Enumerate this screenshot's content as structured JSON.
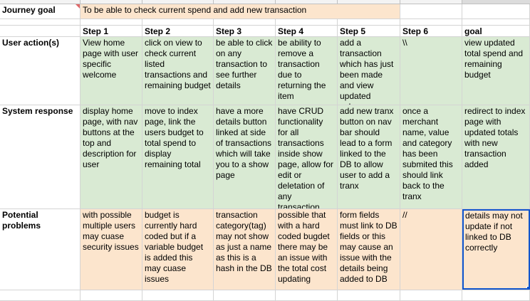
{
  "sheet": {
    "journey_goal_label": "Journey goal",
    "journey_goal_text": "To be able to check current spend and add new transaction",
    "step_headers": [
      "Step 1",
      "Step 2",
      "Step 3",
      "Step 4",
      "Step 5",
      "Step 6",
      "goal"
    ],
    "rows": [
      {
        "label": "User action(s)",
        "cells": [
          "View home page with user specific welcome",
          "click on view to check current listed transactions and remaining budget",
          "be able to click on any transaction to see further details",
          "be ability to remove a transaction due to returning the item",
          "add a transaction which has just been made and view updated values",
          "\\\\",
          "view updated total spend and remaining budget"
        ]
      },
      {
        "label": "System response",
        "cells": [
          "display home page, with nav buttons at the top and description for user",
          "move to index page, link the users budget to total spend to display remaining total",
          "have a more details button linked at side of transactions which will take you to a show page",
          "have CRUD functionality for all transactions inside show page, allow for edit or deletation of any transaction",
          "add new tranx button on nav bar should lead to a form linked to the DB to allow user to add a tranx",
          "once a merchant name, value and category has been submited this should link back to the tranx",
          "redirect to index page with updated totals with new transaction added"
        ]
      },
      {
        "label": "Potential problems",
        "cells": [
          "with possible multiple users may cuase security issues",
          "budget is currently hard coded but if a variable budget is added this may cuase issues",
          "transaction category(tag) may not show as just a name as this is a hash in the DB",
          "possible that with a hard coded bugdet there may be an issue with the total cost updating",
          "form fields must link to DB fields or this may cause an issue with the details being added to DB",
          "//",
          "details may not update if not linked to DB correctly"
        ]
      }
    ]
  },
  "colors": {
    "green": "#d9ead3",
    "peach": "#fce5cd",
    "selection": "#1155cc"
  }
}
